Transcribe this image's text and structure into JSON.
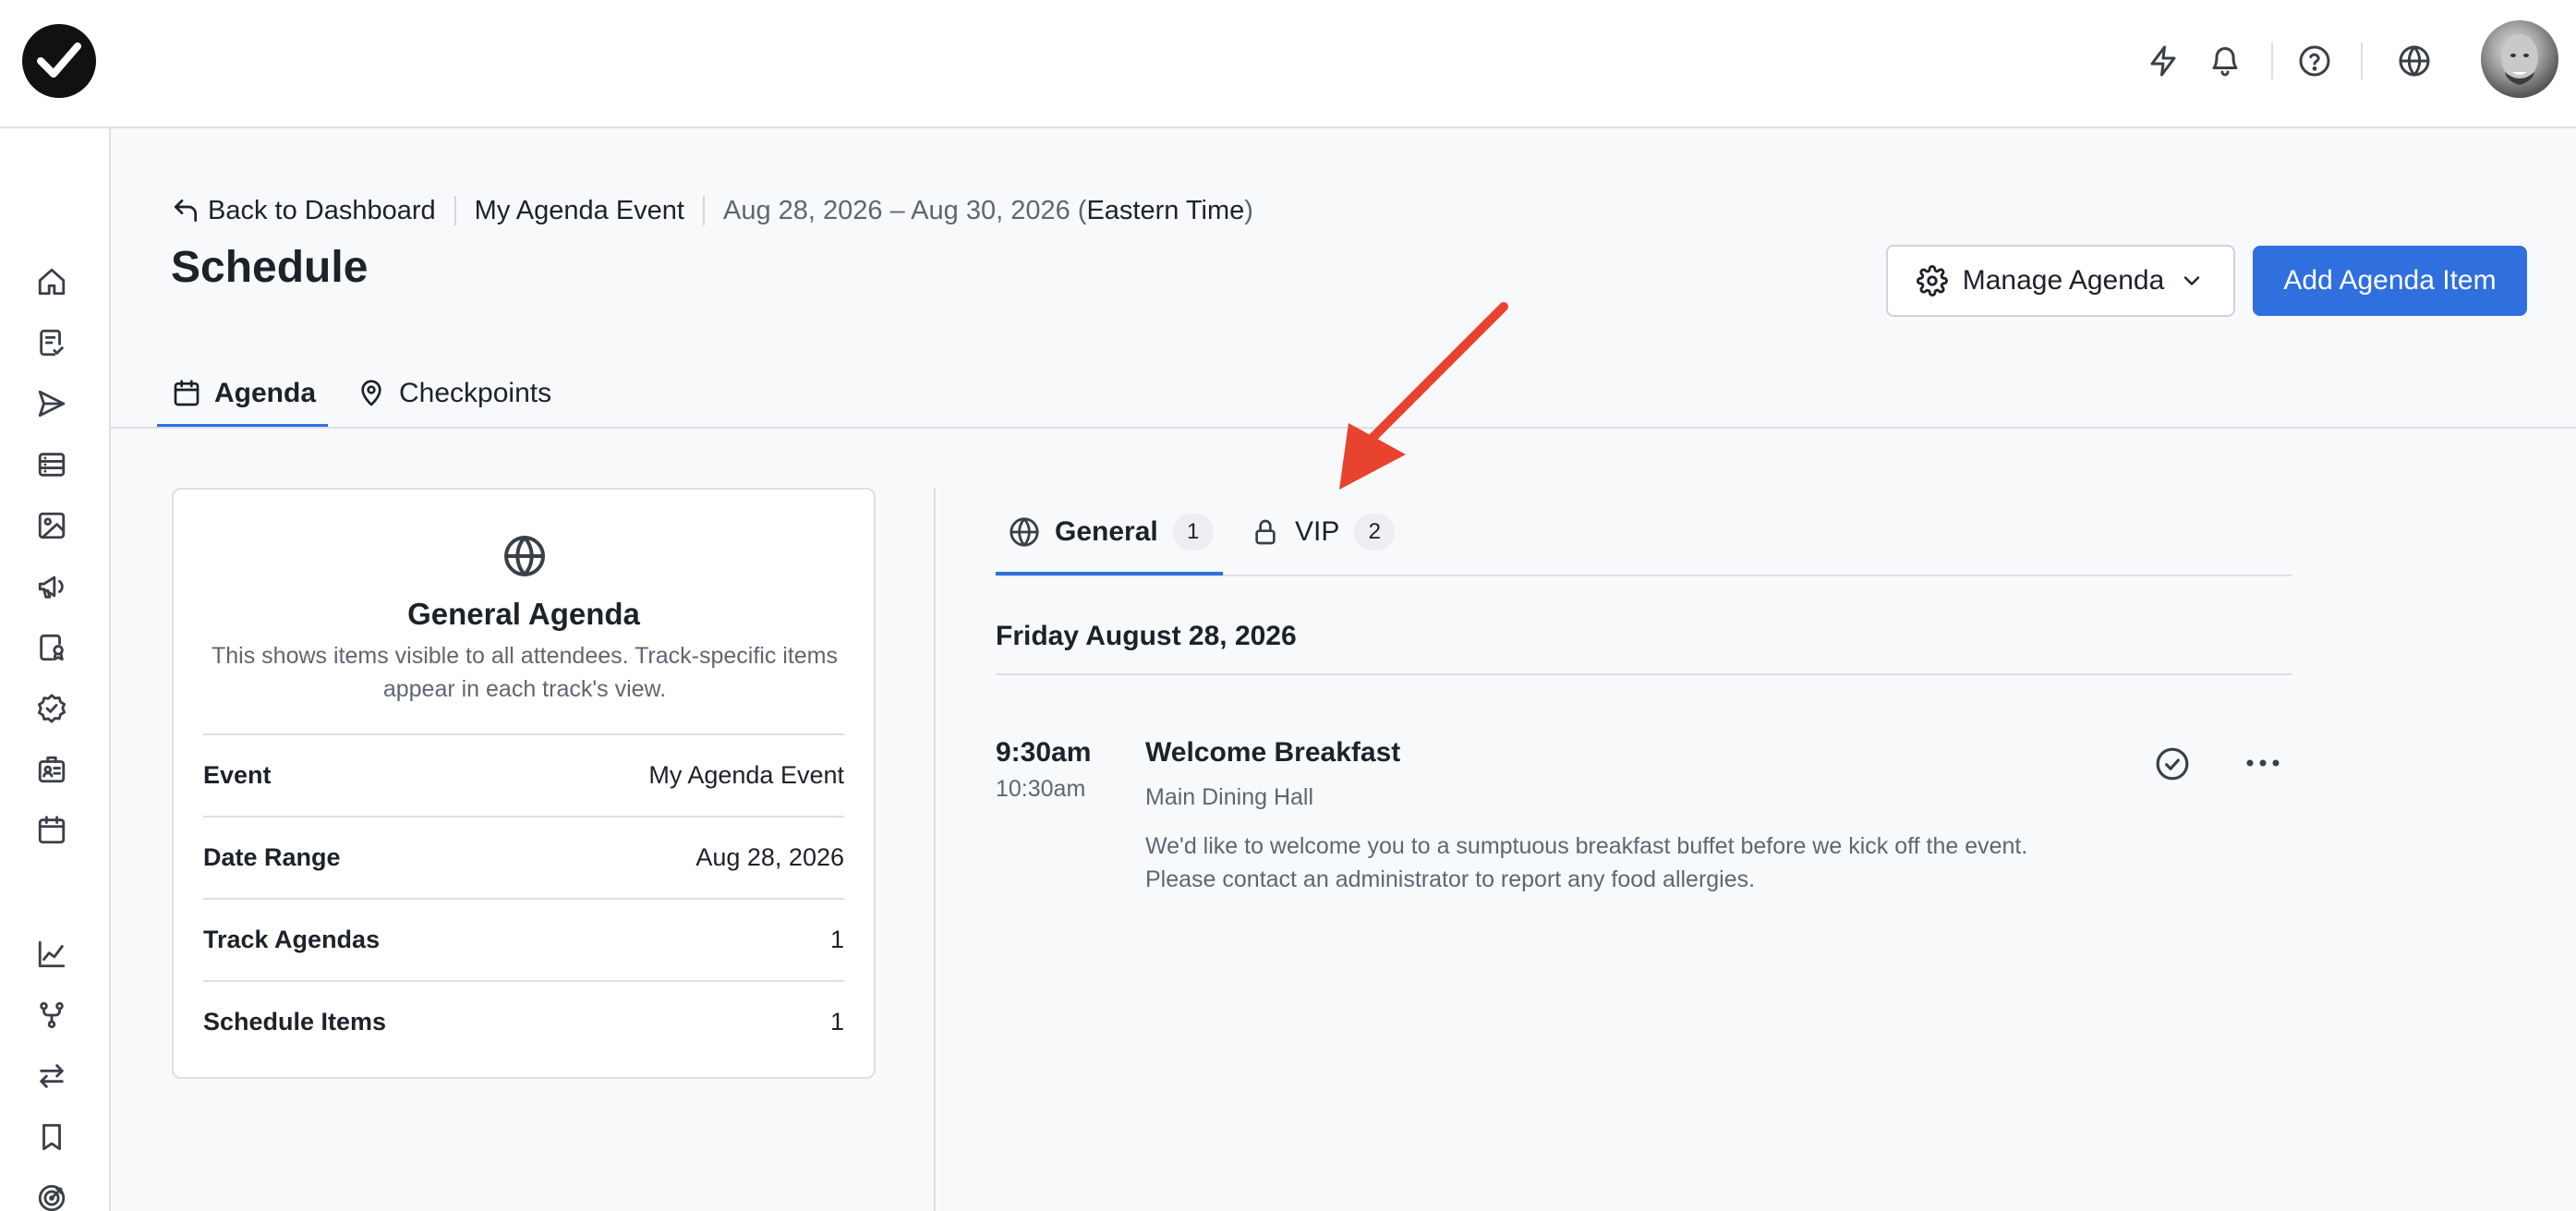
{
  "colors": {
    "accent": "#2f6fde",
    "annotation": "#e8432e",
    "text": "#1d2129",
    "muted": "#5f6672",
    "border": "#dcdfe5"
  },
  "topbar": {
    "icons": [
      "lightning-icon",
      "bell-icon",
      "help-icon",
      "globe-icon"
    ]
  },
  "sidebar": {
    "icons": [
      "home-icon",
      "checklist-icon",
      "send-icon",
      "list-icon",
      "image-icon",
      "megaphone-icon",
      "badge-file-icon",
      "verified-icon",
      "id-badge-icon",
      "calendar-icon",
      "chart-icon",
      "branch-icon",
      "swap-icon",
      "bookmark-icon",
      "target-icon"
    ]
  },
  "header": {
    "back_label": "Back to Dashboard",
    "event_name": "My Agenda Event",
    "date_range": "Aug 28, 2026 – Aug 30, 2026 (",
    "timezone": "Eastern Time",
    "date_close": ")",
    "title": "Schedule",
    "manage_label": "Manage Agenda",
    "add_label": "Add Agenda Item"
  },
  "main_tabs": [
    {
      "label": "Agenda",
      "active": true
    },
    {
      "label": "Checkpoints",
      "active": false
    }
  ],
  "info_card": {
    "title": "General Agenda",
    "description": "This shows items visible to all attendees. Track-specific items appear in each track's view.",
    "rows": [
      {
        "label": "Event",
        "value": "My Agenda Event"
      },
      {
        "label": "Date Range",
        "value": "Aug 28, 2026"
      },
      {
        "label": "Track Agendas",
        "value": "1"
      },
      {
        "label": "Schedule Items",
        "value": "1"
      }
    ]
  },
  "track_tabs": [
    {
      "label": "General",
      "count": "1",
      "active": true
    },
    {
      "label": "VIP",
      "count": "2",
      "active": false
    }
  ],
  "day": {
    "heading": "Friday August 28, 2026"
  },
  "agenda_item": {
    "start": "9:30am",
    "end": "10:30am",
    "title": "Welcome Breakfast",
    "location": "Main Dining Hall",
    "description_line1": "We'd like to welcome you to a sumptuous breakfast buffet before we kick off the event.",
    "description_line2": "Please contact an administrator to report any food allergies."
  }
}
